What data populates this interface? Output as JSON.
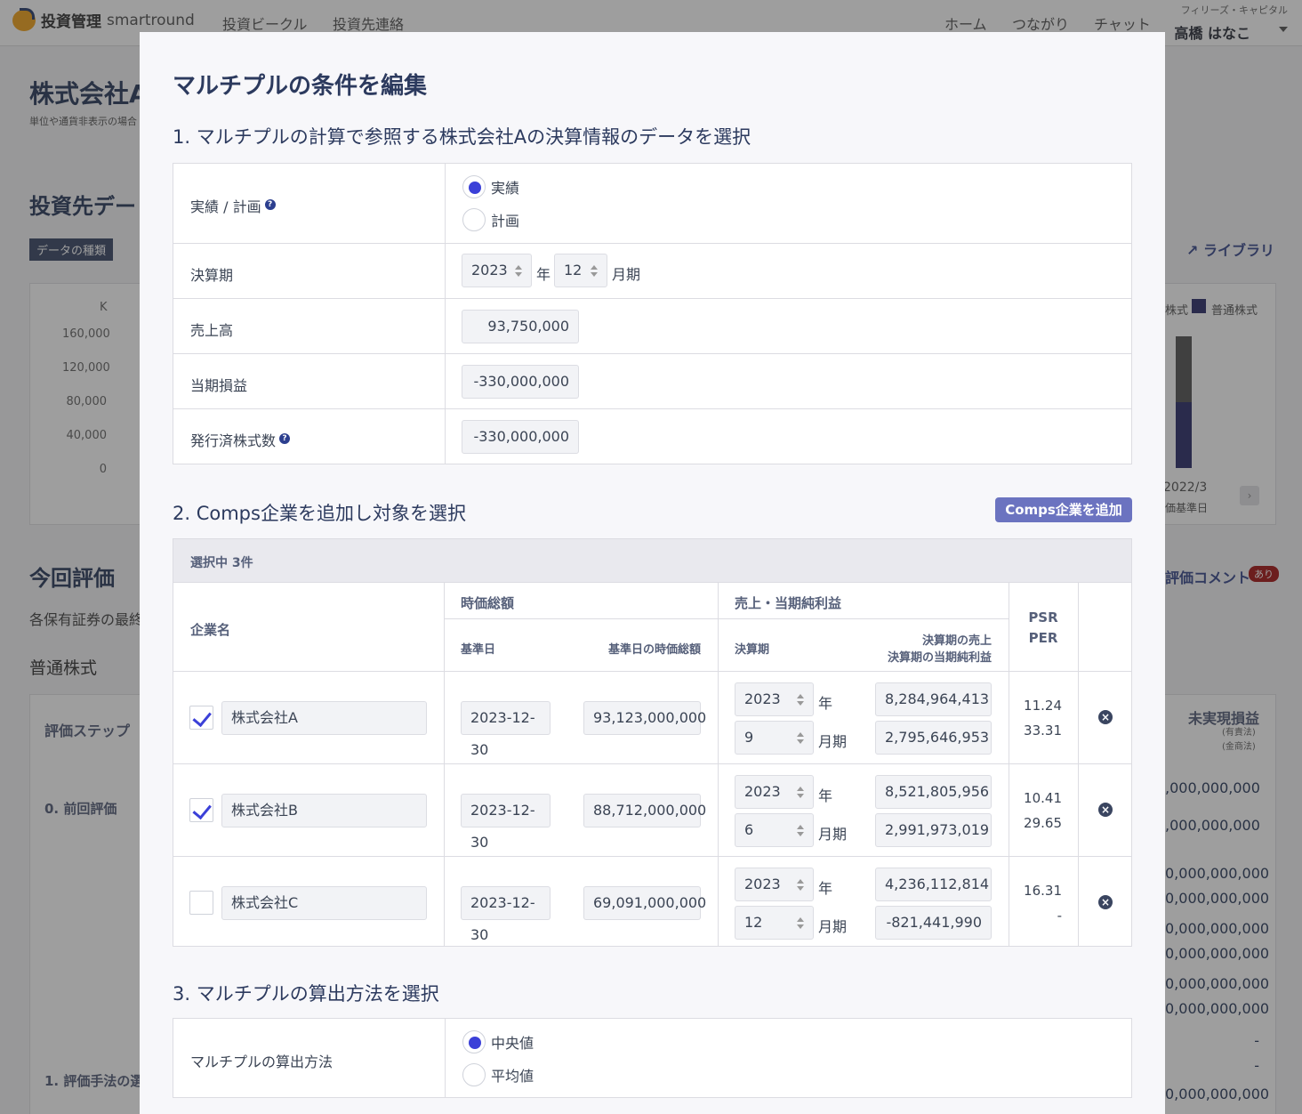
{
  "header": {
    "logo_text": "投資管理",
    "logo_sub": "smartround",
    "nav": [
      "投資ビークル",
      "投資先連絡"
    ],
    "right_nav": [
      "ホーム",
      "つながり",
      "チャット"
    ],
    "org": "フィリーズ・キャピタル",
    "user": "高橋 はなこ"
  },
  "background": {
    "company_title": "株式会社A",
    "company_note": "単位や通貨非表示の場合",
    "section_data": "投資先デー",
    "data_type_tag": "データの種類",
    "library_link": "ライブラリ",
    "chart_unit": "K",
    "y_ticks": [
      "160,000",
      "120,000",
      "80,000",
      "40,000",
      "0"
    ],
    "legend_stock": "株式",
    "legend_common": "普通株式",
    "chart_date": "2022/3",
    "chart_date_sub": "価基準日",
    "section_eval": "今回評価",
    "eval_desc": "各保有証券の最終",
    "eval_comment": "評価コメント",
    "eval_badge": "あり",
    "common_stock": "普通株式",
    "eval_step": "評価ステップ",
    "unrealized": "未実現損益",
    "unrealized_sub1": "(有責法)",
    "unrealized_sub2": "(金商法)",
    "prev_eval": "0. 前回評価",
    "method_label": "1. 評価手法の選",
    "right_values": [
      ",000,000,000",
      ",000,000,000",
      "0,000,000,000",
      "0,000,000,000",
      "0,000,000,000",
      "0,000,000,000",
      "0,000,000,000",
      "0,000,000,000",
      "-",
      "-",
      "0,000,000,000"
    ]
  },
  "modal": {
    "title": "マルチプルの条件を編集",
    "section1": {
      "title": "1. マルチプルの計算で参照する株式会社Aの決算情報のデータを選択",
      "actual_plan_label": "実績 / 計画",
      "opt_actual": "実績",
      "opt_plan": "計画",
      "period_label": "決算期",
      "year": "2023",
      "year_unit": "年",
      "month": "12",
      "month_unit": "月期",
      "sales_label": "売上高",
      "sales": "93,750,000",
      "profit_label": "当期損益",
      "profit": "-330,000,000",
      "shares_label": "発行済株式数",
      "shares": "-330,000,000"
    },
    "section2": {
      "title": "2. Comps企業を追加し対象を選択",
      "add_button": "Comps企業を追加",
      "selected": "選択中 3件",
      "col_company": "企業名",
      "col_mcap": "時価総額",
      "col_base_date": "基準日",
      "col_base_mcap": "基準日の時価総額",
      "col_sales_profit": "売上・当期純利益",
      "col_period": "決算期",
      "col_period_sales": "決算期の売上",
      "col_period_profit": "決算期の当期純利益",
      "col_psr": "PSR",
      "col_per": "PER",
      "year_unit": "年",
      "month_unit": "月期",
      "rows": [
        {
          "checked": true,
          "name": "株式会社A",
          "date": "2023-12-30",
          "mcap": "93,123,000,000",
          "year": "2023",
          "month": "9",
          "sales": "8,284,964,413",
          "profit": "2,795,646,953",
          "psr": "11.24",
          "per": "33.31"
        },
        {
          "checked": true,
          "name": "株式会社B",
          "date": "2023-12-30",
          "mcap": "88,712,000,000",
          "year": "2023",
          "month": "6",
          "sales": "8,521,805,956",
          "profit": "2,991,973,019",
          "psr": "10.41",
          "per": "29.65"
        },
        {
          "checked": false,
          "name": "株式会社C",
          "date": "2023-12-30",
          "mcap": "69,091,000,000",
          "year": "2023",
          "month": "12",
          "sales": "4,236,112,814",
          "profit": "-821,441,990",
          "psr": "16.31",
          "per": "-"
        }
      ]
    },
    "section3": {
      "title": "3. マルチプルの算出方法を選択",
      "method_label": "マルチプルの算出方法",
      "opt_median": "中央値",
      "opt_mean": "平均値"
    }
  }
}
